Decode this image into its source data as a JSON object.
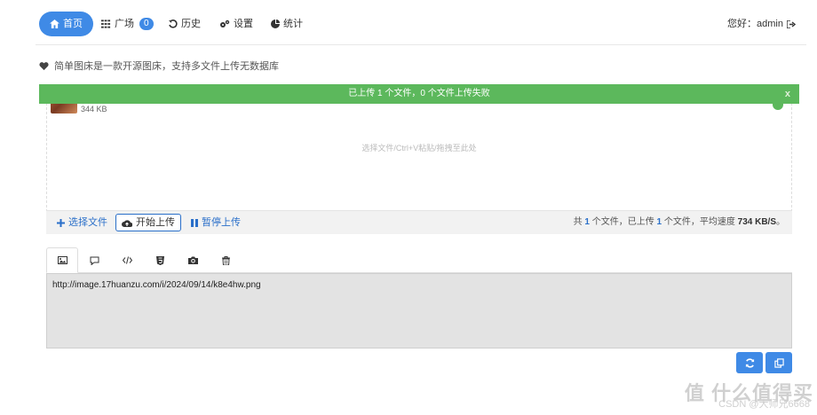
{
  "nav": {
    "home": "首页",
    "plaza": "广场",
    "plaza_count": "0",
    "history": "历史",
    "settings": "设置",
    "stats": "统计",
    "greeting": "您好：admin"
  },
  "tagline": "简单图床是一款开源图床，支持多文件上传无数据库",
  "upload": {
    "banner": "已上传 1 个文件，0 个文件上传失败",
    "banner_close": "x",
    "file_size": "344 KB",
    "drop_hint": "选择文件/Ctrl+V粘贴/拖拽至此处",
    "select_btn": "选择文件",
    "start_btn": "开始上传",
    "pause_btn": "暂停上传",
    "stats": {
      "p1": "共",
      "total": "1",
      "p2": "个文件，已上传",
      "uploaded": "1",
      "p3": "个文件，平均速度",
      "speed": "734 KB/S",
      "p4": "。"
    }
  },
  "output": {
    "url": "http://image.17huanzu.com/i/2024/09/14/k8e4hw.png"
  },
  "watermark": {
    "main": "值 什么值得买",
    "sub": "CSDN @大师兄6668"
  },
  "colors": {
    "primary": "#3f8ae6",
    "success": "#5cb85c",
    "link": "#2a6fc9"
  }
}
